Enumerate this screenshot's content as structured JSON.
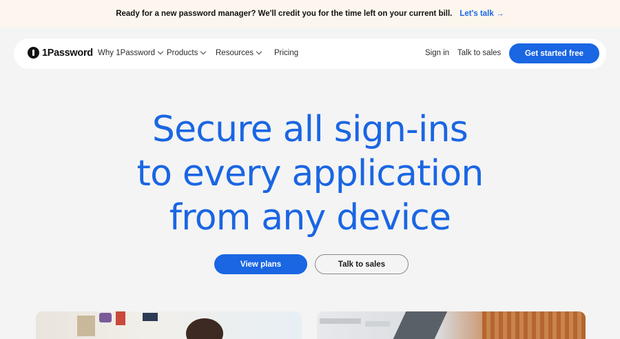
{
  "promo": {
    "text": "Ready for a new password manager? We'll credit you for the time left on your current bill.",
    "link": "Let's talk",
    "arrow": "→"
  },
  "nav": {
    "logo": "1Password",
    "items": [
      {
        "label": "Why 1Password",
        "dropdown": true
      },
      {
        "label": "Products",
        "dropdown": true
      },
      {
        "label": "Resources",
        "dropdown": true
      },
      {
        "label": "Pricing",
        "dropdown": false
      }
    ],
    "sign_in": "Sign in",
    "talk_to_sales": "Talk to sales",
    "cta": "Get started free"
  },
  "hero": {
    "lines": [
      "Secure all sign-ins",
      "to every application",
      "from any device"
    ],
    "primary_button": "View plans",
    "secondary_button": "Talk to sales"
  },
  "colors": {
    "accent": "#1a66e3",
    "banner_bg": "#fcf6ee",
    "page_bg": "#f4f4f4"
  }
}
